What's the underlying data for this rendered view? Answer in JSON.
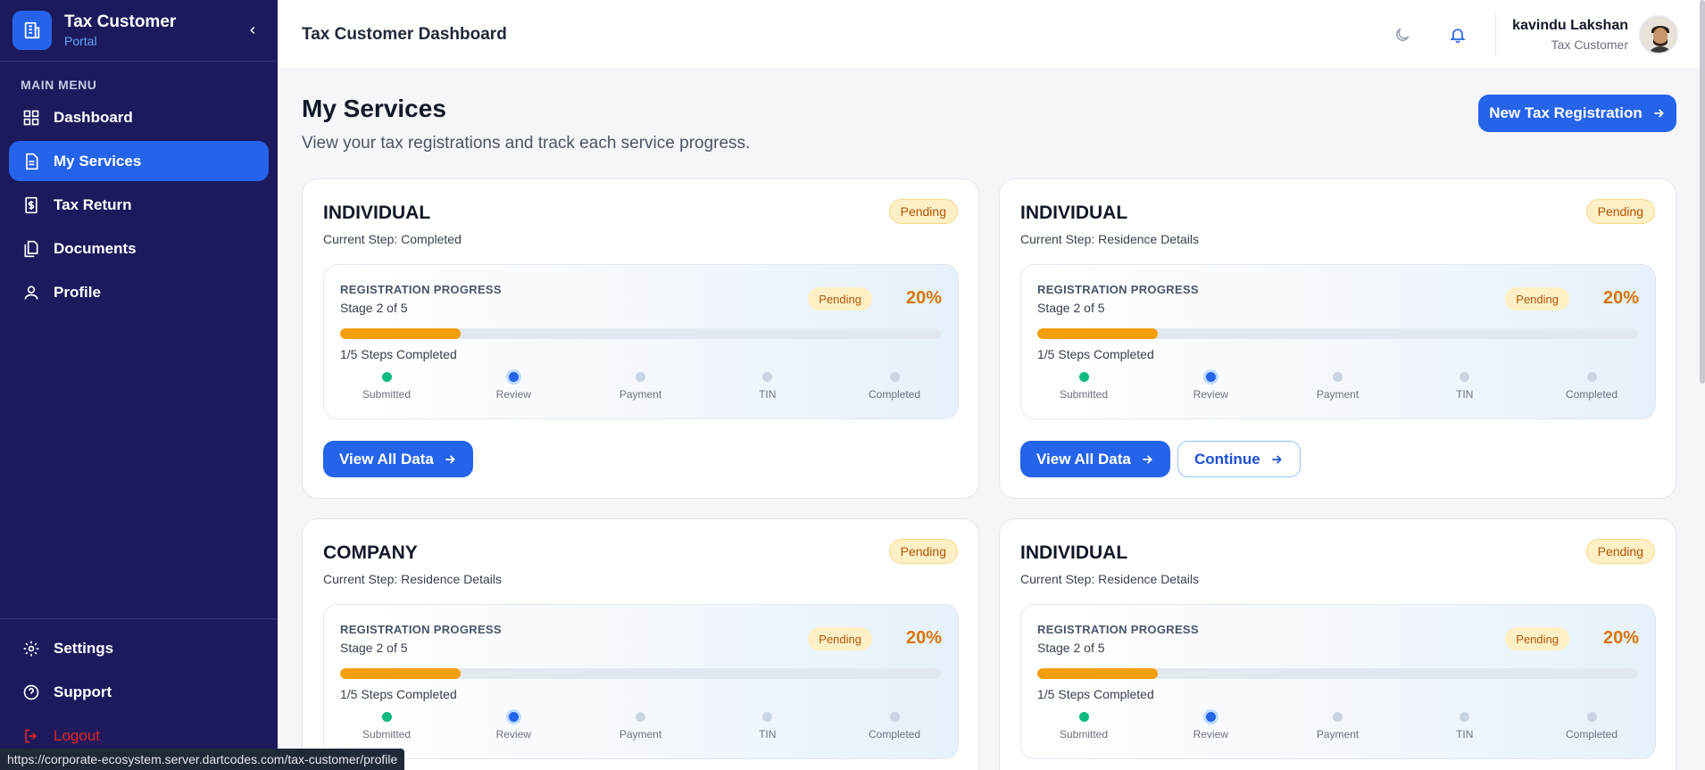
{
  "brand": {
    "title": "Tax Customer",
    "subtitle": "Portal"
  },
  "sidebar": {
    "menu_label": "MAIN MENU",
    "items": [
      {
        "label": "Dashboard",
        "icon": "grid-icon",
        "active": false
      },
      {
        "label": "My Services",
        "icon": "document-icon",
        "active": true
      },
      {
        "label": "Tax Return",
        "icon": "receipt-icon",
        "active": false
      },
      {
        "label": "Documents",
        "icon": "files-icon",
        "active": false
      },
      {
        "label": "Profile",
        "icon": "user-icon",
        "active": false
      }
    ],
    "bottom": [
      {
        "label": "Settings",
        "icon": "gear-icon"
      },
      {
        "label": "Support",
        "icon": "help-circle-icon"
      },
      {
        "label": "Logout",
        "icon": "logout-icon"
      }
    ]
  },
  "header": {
    "title": "Tax Customer Dashboard",
    "user_name": "kavindu Lakshan",
    "user_role": "Tax Customer"
  },
  "main": {
    "title": "My Services",
    "subtitle": "View your tax registrations and track each service progress.",
    "new_button": "New Tax Registration"
  },
  "cards": [
    {
      "type": "INDIVIDUAL",
      "current_step": "Current Step: Completed",
      "status": "Pending",
      "progress_label": "REGISTRATION PROGRESS",
      "stage": "Stage 2 of 5",
      "progress_status": "Pending",
      "percent_text": "20%",
      "percent": 0.2,
      "steps_completed": "1/5 Steps Completed",
      "steps": [
        {
          "label": "Submitted",
          "state": "done"
        },
        {
          "label": "Review",
          "state": "current"
        },
        {
          "label": "Payment",
          "state": "todo"
        },
        {
          "label": "TIN",
          "state": "todo"
        },
        {
          "label": "Completed",
          "state": "todo"
        }
      ],
      "view_button": "View All Data",
      "continue_button": null
    },
    {
      "type": "INDIVIDUAL",
      "current_step": "Current Step: Residence Details",
      "status": "Pending",
      "progress_label": "REGISTRATION PROGRESS",
      "stage": "Stage 2 of 5",
      "progress_status": "Pending",
      "percent_text": "20%",
      "percent": 0.2,
      "steps_completed": "1/5 Steps Completed",
      "steps": [
        {
          "label": "Submitted",
          "state": "done"
        },
        {
          "label": "Review",
          "state": "current"
        },
        {
          "label": "Payment",
          "state": "todo"
        },
        {
          "label": "TIN",
          "state": "todo"
        },
        {
          "label": "Completed",
          "state": "todo"
        }
      ],
      "view_button": "View All Data",
      "continue_button": "Continue"
    },
    {
      "type": "COMPANY",
      "current_step": "Current Step: Residence Details",
      "status": "Pending",
      "progress_label": "REGISTRATION PROGRESS",
      "stage": "Stage 2 of 5",
      "progress_status": "Pending",
      "percent_text": "20%",
      "percent": 0.2,
      "steps_completed": "1/5 Steps Completed",
      "steps": [
        {
          "label": "Submitted",
          "state": "done"
        },
        {
          "label": "Review",
          "state": "current"
        },
        {
          "label": "Payment",
          "state": "todo"
        },
        {
          "label": "TIN",
          "state": "todo"
        },
        {
          "label": "Completed",
          "state": "todo"
        }
      ],
      "view_button": null,
      "continue_button": null
    },
    {
      "type": "INDIVIDUAL",
      "current_step": "Current Step: Residence Details",
      "status": "Pending",
      "progress_label": "REGISTRATION PROGRESS",
      "stage": "Stage 2 of 5",
      "progress_status": "Pending",
      "percent_text": "20%",
      "percent": 0.2,
      "steps_completed": "1/5 Steps Completed",
      "steps": [
        {
          "label": "Submitted",
          "state": "done"
        },
        {
          "label": "Review",
          "state": "current"
        },
        {
          "label": "Payment",
          "state": "todo"
        },
        {
          "label": "TIN",
          "state": "todo"
        },
        {
          "label": "Completed",
          "state": "todo"
        }
      ],
      "view_button": null,
      "continue_button": null
    }
  ],
  "status_bar": {
    "url": "https://corporate-ecosystem.server.dartcodes.com/tax-customer/profile"
  },
  "colors": {
    "sidebar": "#1c1a5c",
    "accent": "#2563eb",
    "pending": "#f59e0b",
    "done": "#10b981",
    "logout": "#dc2626"
  }
}
